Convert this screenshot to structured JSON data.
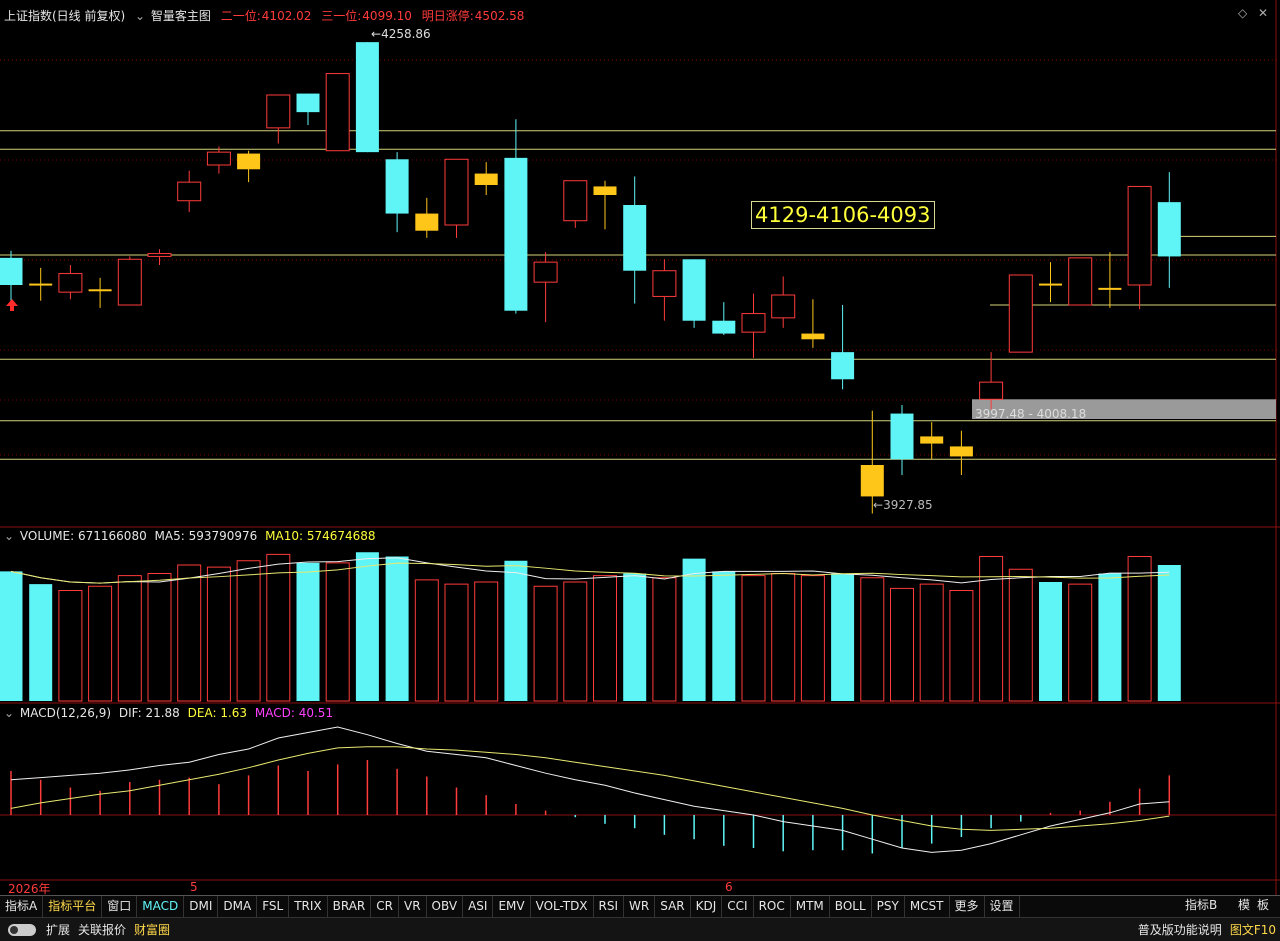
{
  "header": {
    "symbol": "上证指数(日线 前复权)",
    "indicator": "智量客主图",
    "level2_label": "二一位:",
    "level2_value": "4102.02",
    "level3_label": "三一位:",
    "level3_value": "4099.10",
    "limit_label": "明日涨停:",
    "limit_value": "4502.58"
  },
  "annotations": {
    "high": "4258.86",
    "low": "3927.85",
    "zone": "3997.48 - 4008.18",
    "levels_box": "4129-4106-4093"
  },
  "volume_header": {
    "volume": "VOLUME: 671166080",
    "ma5": "MA5: 593790976",
    "ma10": "MA10: 574674688"
  },
  "macd_header": {
    "name": "MACD(12,26,9)",
    "dif": "DIF: 21.88",
    "dea": "DEA: 1.63",
    "macd": "MACD: 40.51"
  },
  "date_axis": {
    "year": "2026年",
    "month5": "5",
    "month6": "6"
  },
  "toolbar": [
    "指标A",
    "指标平台",
    "窗口",
    "MACD",
    "DMI",
    "DMA",
    "FSL",
    "TRIX",
    "BRAR",
    "CR",
    "VR",
    "OBV",
    "ASI",
    "EMV",
    "VOL-TDX",
    "RSI",
    "WR",
    "SAR",
    "KDJ",
    "CCI",
    "ROC",
    "MTM",
    "BOLL",
    "PSY",
    "MCST",
    "更多",
    "设置"
  ],
  "toolbar_right": [
    "指标B",
    "模",
    "板"
  ],
  "statusbar": {
    "expand": "扩展",
    "related": "关联报价",
    "wealth": "财富圈",
    "help": "普及版功能说明",
    "f10": "图文F10"
  },
  "colors": {
    "up": "#ff3b3b",
    "down": "#5ff5f7",
    "flat": "#ffc61a",
    "ma": "#e8e870",
    "grid": "#7a0000",
    "hline": "#d4d47a"
  },
  "chart_data": {
    "type": "candlestick",
    "candles": [
      {
        "o": 4107,
        "c": 4088,
        "h": 4112,
        "l": 4074,
        "t": "d"
      },
      {
        "o": 4089,
        "c": 4089,
        "h": 4100,
        "l": 4077,
        "t": "f"
      },
      {
        "o": 4096,
        "c": 4083,
        "h": 4102,
        "l": 4078,
        "t": "u"
      },
      {
        "o": 4085,
        "c": 4084,
        "h": 4093,
        "l": 4072,
        "t": "f"
      },
      {
        "o": 4074,
        "c": 4106,
        "h": 4108,
        "l": 4074,
        "t": "u"
      },
      {
        "o": 4108,
        "c": 4110,
        "h": 4113,
        "l": 4102,
        "t": "u"
      },
      {
        "o": 4147,
        "c": 4160,
        "h": 4168,
        "l": 4139,
        "t": "u"
      },
      {
        "o": 4172,
        "c": 4181,
        "h": 4185,
        "l": 4166,
        "t": "u"
      },
      {
        "o": 4180,
        "c": 4169,
        "h": 4182,
        "l": 4160,
        "t": "f"
      },
      {
        "o": 4198,
        "c": 4221,
        "h": 4221,
        "l": 4187,
        "t": "u"
      },
      {
        "o": 4222,
        "c": 4209,
        "h": 4222,
        "l": 4200,
        "t": "d"
      },
      {
        "o": 4182,
        "c": 4236,
        "h": 4236,
        "l": 4182,
        "t": "u"
      },
      {
        "o": 4258,
        "c": 4181,
        "h": 4258,
        "l": 4181,
        "t": "d"
      },
      {
        "o": 4176,
        "c": 4138,
        "h": 4181,
        "l": 4125,
        "t": "d"
      },
      {
        "o": 4138,
        "c": 4126,
        "h": 4149,
        "l": 4121,
        "t": "f"
      },
      {
        "o": 4130,
        "c": 4176,
        "h": 4176,
        "l": 4121,
        "t": "u"
      },
      {
        "o": 4166,
        "c": 4158,
        "h": 4174,
        "l": 4151,
        "t": "f"
      },
      {
        "o": 4177,
        "c": 4070,
        "h": 4204,
        "l": 4068,
        "t": "d"
      },
      {
        "o": 4090,
        "c": 4104,
        "h": 4111,
        "l": 4062,
        "t": "u"
      },
      {
        "o": 4133,
        "c": 4161,
        "h": 4161,
        "l": 4128,
        "t": "u"
      },
      {
        "o": 4157,
        "c": 4151,
        "h": 4161,
        "l": 4127,
        "t": "f"
      },
      {
        "o": 4144,
        "c": 4098,
        "h": 4164,
        "l": 4075,
        "t": "d"
      },
      {
        "o": 4080,
        "c": 4098,
        "h": 4106,
        "l": 4063,
        "t": "u"
      },
      {
        "o": 4106,
        "c": 4063,
        "h": 4106,
        "l": 4058,
        "t": "d"
      },
      {
        "o": 4063,
        "c": 4054,
        "h": 4076,
        "l": 4053,
        "t": "d"
      },
      {
        "o": 4055,
        "c": 4068,
        "h": 4082,
        "l": 4037,
        "t": "u"
      },
      {
        "o": 4065,
        "c": 4081,
        "h": 4094,
        "l": 4058,
        "t": "u"
      },
      {
        "o": 4054,
        "c": 4050,
        "h": 4078,
        "l": 4044,
        "t": "f"
      },
      {
        "o": 4041,
        "c": 4022,
        "h": 4074,
        "l": 4015,
        "t": "d"
      },
      {
        "o": 3962,
        "c": 3940,
        "h": 4000,
        "l": 3928,
        "t": "f"
      },
      {
        "o": 3998,
        "c": 3966,
        "h": 4004,
        "l": 3955,
        "t": "d"
      },
      {
        "o": 3982,
        "c": 3977,
        "h": 3992,
        "l": 3966,
        "t": "f"
      },
      {
        "o": 3975,
        "c": 3968,
        "h": 3986,
        "l": 3955,
        "t": "f"
      },
      {
        "o": 4008,
        "c": 4020,
        "h": 4041,
        "l": 4001,
        "t": "u"
      },
      {
        "o": 4041,
        "c": 4095,
        "h": 4095,
        "l": 4041,
        "t": "u"
      },
      {
        "o": 4089,
        "c": 4089,
        "h": 4104,
        "l": 4076,
        "t": "f"
      },
      {
        "o": 4074,
        "c": 4107,
        "h": 4107,
        "l": 4074,
        "t": "u"
      },
      {
        "o": 4086,
        "c": 4086,
        "h": 4111,
        "l": 4072,
        "t": "f"
      },
      {
        "o": 4088,
        "c": 4157,
        "h": 4157,
        "l": 4071,
        "t": "u"
      },
      {
        "o": 4146,
        "c": 4108,
        "h": 4167,
        "l": 4086,
        "t": "d"
      }
    ],
    "ylim": [
      3920,
      4270
    ],
    "hlines": [
      4196,
      4183,
      4109,
      4036,
      3993,
      3966,
      4074
    ],
    "volume": [
      {
        "v": 6.1,
        "t": "d"
      },
      {
        "v": 5.5,
        "t": "d"
      },
      {
        "v": 5.2,
        "t": "u"
      },
      {
        "v": 5.4,
        "t": "u"
      },
      {
        "v": 5.9,
        "t": "u"
      },
      {
        "v": 6.0,
        "t": "u"
      },
      {
        "v": 6.4,
        "t": "u"
      },
      {
        "v": 6.3,
        "t": "u"
      },
      {
        "v": 6.6,
        "t": "u"
      },
      {
        "v": 6.9,
        "t": "u"
      },
      {
        "v": 6.5,
        "t": "d"
      },
      {
        "v": 6.5,
        "t": "u"
      },
      {
        "v": 7.0,
        "t": "d"
      },
      {
        "v": 6.8,
        "t": "d"
      },
      {
        "v": 5.7,
        "t": "u"
      },
      {
        "v": 5.5,
        "t": "u"
      },
      {
        "v": 5.6,
        "t": "u"
      },
      {
        "v": 6.6,
        "t": "d"
      },
      {
        "v": 5.4,
        "t": "u"
      },
      {
        "v": 5.6,
        "t": "u"
      },
      {
        "v": 5.9,
        "t": "u"
      },
      {
        "v": 6.0,
        "t": "d"
      },
      {
        "v": 5.8,
        "t": "u"
      },
      {
        "v": 6.7,
        "t": "d"
      },
      {
        "v": 6.1,
        "t": "d"
      },
      {
        "v": 5.9,
        "t": "u"
      },
      {
        "v": 6.0,
        "t": "u"
      },
      {
        "v": 5.9,
        "t": "u"
      },
      {
        "v": 6.0,
        "t": "d"
      },
      {
        "v": 5.8,
        "t": "u"
      },
      {
        "v": 5.3,
        "t": "u"
      },
      {
        "v": 5.5,
        "t": "u"
      },
      {
        "v": 5.2,
        "t": "u"
      },
      {
        "v": 6.8,
        "t": "u"
      },
      {
        "v": 6.2,
        "t": "u"
      },
      {
        "v": 5.6,
        "t": "d"
      },
      {
        "v": 5.5,
        "t": "u"
      },
      {
        "v": 6.0,
        "t": "d"
      },
      {
        "v": 6.8,
        "t": "u"
      },
      {
        "v": 6.4,
        "t": "d"
      }
    ],
    "macd_hist": [
      40,
      32,
      25,
      22,
      30,
      32,
      34,
      28,
      36,
      45,
      40,
      46,
      50,
      42,
      35,
      25,
      18,
      10,
      4,
      -2,
      -8,
      -12,
      -18,
      -22,
      -28,
      -30,
      -33,
      -32,
      -32,
      -35,
      -30,
      -26,
      -20,
      -12,
      -6,
      2,
      4,
      12,
      24,
      36
    ],
    "dif": [
      32,
      34,
      36,
      38,
      41,
      45,
      48,
      55,
      60,
      70,
      75,
      80,
      73,
      65,
      58,
      55,
      52,
      45,
      38,
      32,
      27,
      20,
      14,
      8,
      4,
      0,
      -6,
      -10,
      -14,
      -22,
      -30,
      -34,
      -32,
      -26,
      -18,
      -10,
      -4,
      2,
      10,
      12
    ],
    "dea": [
      6,
      11,
      15,
      19,
      22,
      27,
      32,
      37,
      43,
      50,
      56,
      61,
      62,
      62,
      60,
      59,
      57,
      55,
      52,
      48,
      44,
      40,
      36,
      31,
      26,
      21,
      16,
      11,
      6,
      0,
      -5,
      -10,
      -13,
      -14,
      -13,
      -12,
      -10,
      -8,
      -5,
      -1
    ]
  }
}
